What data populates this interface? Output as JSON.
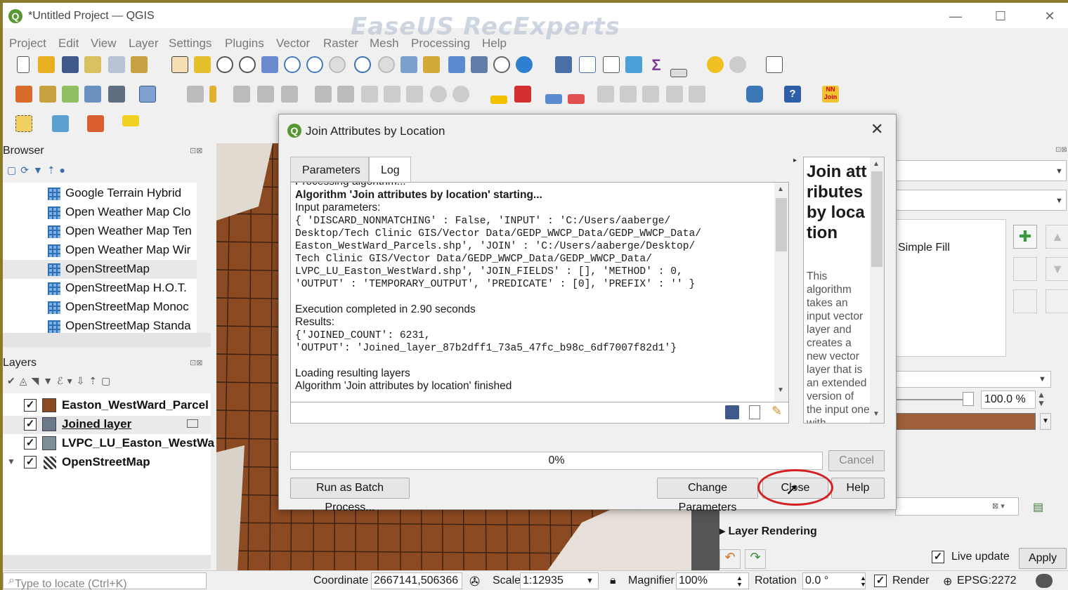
{
  "window": {
    "title": "*Untitled Project — QGIS",
    "watermark": "EaseUS RecExperts",
    "controls": [
      "—",
      "☐",
      "✕"
    ]
  },
  "menu": [
    "Project",
    "Edit",
    "View",
    "Layer",
    "Settings",
    "Plugins",
    "Vector",
    "Raster",
    "Mesh",
    "Processing",
    "Help"
  ],
  "browser": {
    "header": "Browser",
    "items": [
      "Google Terrain Hybrid",
      "Open Weather Map Clo",
      "Open Weather Map Ten",
      "Open Weather Map Wir",
      "OpenStreetMap",
      "OpenStreetMap H.O.T.",
      "OpenStreetMap Monoc",
      "OpenStreetMap Standa"
    ]
  },
  "layers": {
    "header": "Layers",
    "items": [
      {
        "name": "Easton_WestWard_Parcel",
        "color": "#8b4a22"
      },
      {
        "name": "Joined layer",
        "color": "#6a7a8c"
      },
      {
        "name": "LVPC_LU_Easton_WestWa",
        "color": "#7f8f9a"
      },
      {
        "name": "OpenStreetMap",
        "color": ""
      }
    ]
  },
  "dialog": {
    "title": "Join Attributes by Location",
    "tabs": [
      "Parameters",
      "Log"
    ],
    "log": {
      "line0": "Processing algorithm...",
      "start": "Algorithm 'Join attributes by location' starting...",
      "input_label": "Input parameters:",
      "params": [
        "{ 'DISCARD_NONMATCHING' : False, 'INPUT' : 'C:/Users/aaberge/",
        "Desktop/Tech Clinic GIS/Vector Data/GEDP_WWCP_Data/GEDP_WWCP_Data/",
        "Easton_WestWard_Parcels.shp', 'JOIN' : 'C:/Users/aaberge/Desktop/",
        "Tech Clinic GIS/Vector Data/GEDP_WWCP_Data/GEDP_WWCP_Data/",
        "LVPC_LU_Easton_WestWard.shp', 'JOIN_FIELDS' : [], 'METHOD' : 0,",
        "'OUTPUT' : 'TEMPORARY_OUTPUT', 'PREDICATE' : [0], 'PREFIX' : '' }"
      ],
      "execution": "Execution completed in 2.90 seconds",
      "results_label": "Results:",
      "results": [
        "{'JOINED_COUNT': 6231,",
        "'OUTPUT': 'Joined_layer_87b2dff1_73a5_47fc_b98c_6df7007f82d1'}"
      ],
      "loading": "Loading resulting layers",
      "finished": "Algorithm 'Join attributes by location' finished"
    },
    "help_title": "Join attributes by location",
    "help_text": "This algorithm takes an input vector layer and creates a new vector layer that is an extended version of the input one with",
    "progress": 0,
    "progress_label": "0%",
    "buttons": {
      "cancel": "Cancel",
      "batch": "Run as Batch Process...",
      "change": "Change Parameters",
      "close": "Close",
      "help": "Help"
    }
  },
  "style_panel": {
    "symbol": "Simple Fill",
    "opacity": "100.0 %",
    "layer_rendering": "Layer Rendering",
    "live_update": "Live update",
    "apply": "Apply"
  },
  "status": {
    "locator_placeholder": "Type to locate (Ctrl+K)",
    "coordinate_label": "Coordinate",
    "coordinate": "2667141,506366",
    "scale_label": "Scale",
    "scale": "1:12935",
    "magnifier_label": "Magnifier",
    "magnifier": "100%",
    "rotation_label": "Rotation",
    "rotation": "0.0 °",
    "render": "Render",
    "crs": "EPSG:2272"
  }
}
